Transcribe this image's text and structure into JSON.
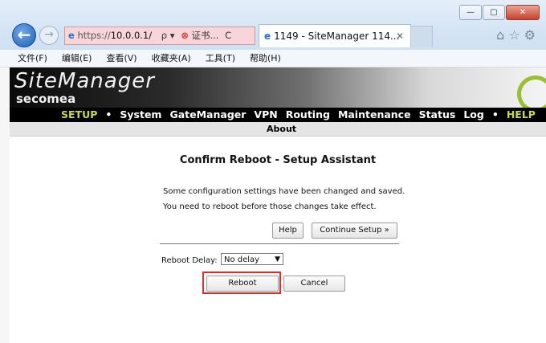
{
  "browser": {
    "address_protocol": "https://",
    "address_host": "10.0.0.1/",
    "search_icon": "ρ ▾",
    "cert_error_label": "证书...",
    "refresh_icon": "C",
    "tab_title": "1149 - SiteManager 114...",
    "tab_close": "✕",
    "back_glyph": "←",
    "forward_glyph": "→",
    "toolbar_icons": "⌂☆⚙"
  },
  "window_controls": {
    "minimize": "—",
    "maximize": "▢",
    "close": "✕"
  },
  "menu": [
    "文件(F)",
    "编辑(E)",
    "查看(V)",
    "收藏夹(A)",
    "工具(T)",
    "帮助(H)"
  ],
  "banner": {
    "logo_main": "SiteManager",
    "logo_sub": "secomea"
  },
  "nav": {
    "items": [
      "SETUP",
      "•",
      "System",
      "GateManager",
      "VPN",
      "Routing",
      "Maintenance",
      "Status",
      "Log",
      "•",
      "HELP"
    ],
    "sub_item": "About"
  },
  "page": {
    "title": "Confirm Reboot - Setup Assistant",
    "message_1": "Some configuration settings have been changed and saved.",
    "message_2": "You need to reboot before those changes take effect.",
    "help_button": "Help",
    "continue_button": "Continue Setup »",
    "delay_label": "Reboot Delay:",
    "delay_value": "No delay",
    "reboot_button": "Reboot",
    "cancel_button": "Cancel"
  },
  "colors": {
    "accent_nav": "#c9d846",
    "highlight": "#e22c2c",
    "address_bg": "#f8d5d8"
  }
}
